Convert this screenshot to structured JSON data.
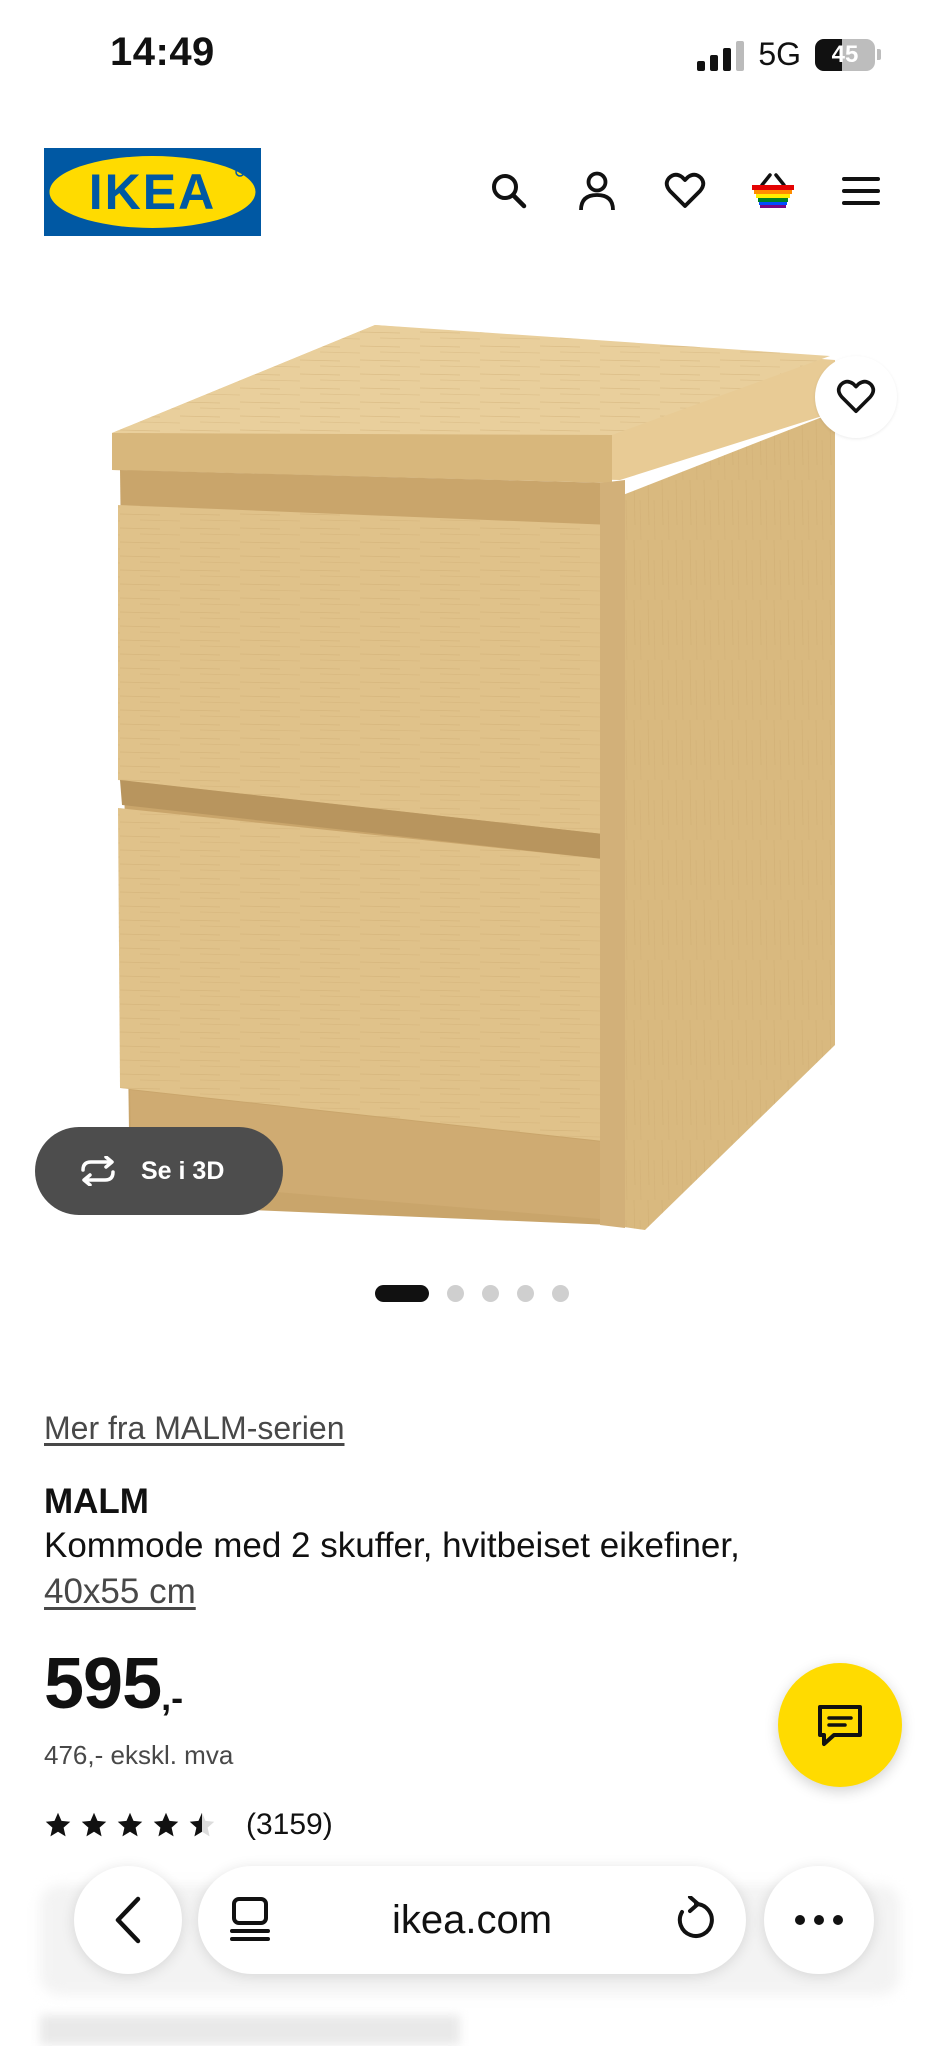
{
  "status_bar": {
    "time": "14:49",
    "network": "5G",
    "battery": "45",
    "battery_level": 0.45
  },
  "header": {
    "logo_text": "IKEA",
    "icons": [
      "search-icon",
      "user-icon",
      "heart-icon",
      "basket-icon",
      "menu-icon"
    ]
  },
  "gallery": {
    "view_3d_label": "Se i 3D",
    "image_count": 5,
    "active_index": 0
  },
  "product": {
    "series_link": "Mer fra MALM-serien",
    "name": "MALM",
    "description": "Kommode med 2 skuffer, hvitbeiset eikefiner,",
    "size": "40x55 cm",
    "price": "595",
    "price_suffix": ",-",
    "price_ex_vat": "476,- ekskl. mva",
    "rating": 4.5,
    "rating_count": "(3159)"
  },
  "browser": {
    "url": "ikea.com"
  },
  "colors": {
    "ikea_blue": "#0058a3",
    "ikea_yellow": "#ffdb00",
    "wood": "#e3c48f"
  }
}
